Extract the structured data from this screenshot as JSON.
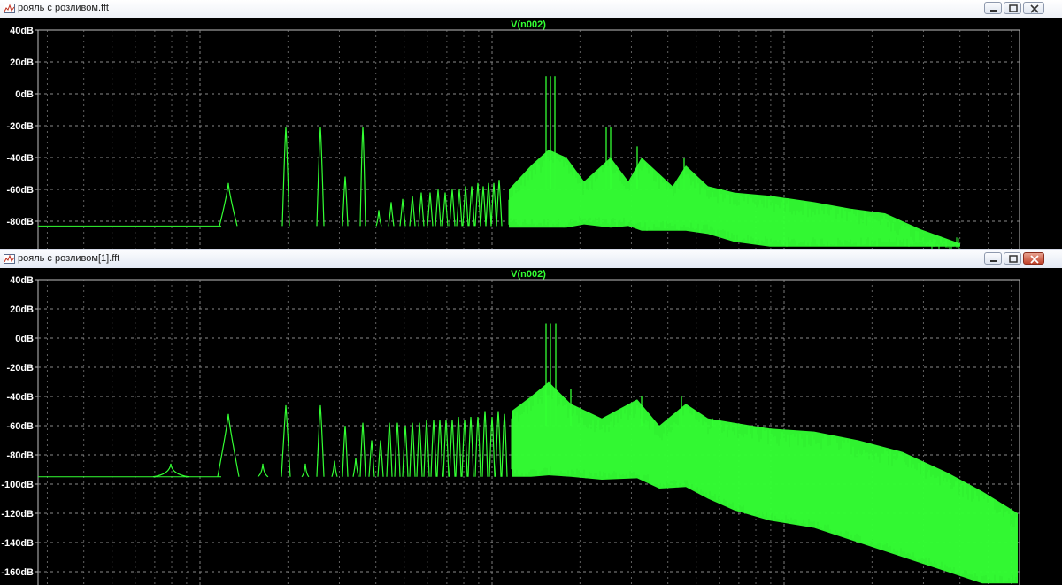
{
  "colors": {
    "trace": "#33ff33",
    "axis": "#bfbfbf",
    "grid": "#8a8a8a",
    "background": "#000000"
  },
  "windows": [
    {
      "title": "рояль с розливом.fft",
      "trace_label": "V(n002)",
      "y_ticks": [
        "40dB",
        "20dB",
        "0dB",
        "-20dB",
        "-40dB",
        "-60dB",
        "-80dB"
      ],
      "icons": [
        "app-icon",
        "minimize-icon",
        "maximize-icon",
        "close-icon"
      ]
    },
    {
      "title": "рояль с розливом[1].fft",
      "trace_label": "V(n002)",
      "y_ticks": [
        "40dB",
        "20dB",
        "0dB",
        "-20dB",
        "-40dB",
        "-60dB",
        "-80dB",
        "-100dB",
        "-120dB",
        "-140dB",
        "-160dB"
      ],
      "icons": [
        "app-icon",
        "minimize-icon",
        "maximize-icon",
        "close-icon"
      ]
    }
  ],
  "chart_data": [
    {
      "type": "line",
      "title": "V(n002)",
      "xlabel": "",
      "ylabel": "",
      "y_unit": "dB",
      "ylim_visible": [
        -96,
        40
      ],
      "x_scale": "log",
      "grid": true,
      "series": [
        {
          "name": "V(n002)",
          "peaks": [
            {
              "x_rel": 0.22,
              "db": -56
            },
            {
              "x_rel": 0.29,
              "db": -21
            },
            {
              "x_rel": 0.33,
              "db": -21
            },
            {
              "x_rel": 0.37,
              "db": -23
            },
            {
              "x_rel": 0.55,
              "db": 11
            },
            {
              "x_rel": 0.57,
              "db": 11
            },
            {
              "x_rel": 0.62,
              "db": -21
            },
            {
              "x_rel": 0.66,
              "db": -35
            },
            {
              "x_rel": 0.71,
              "db": -40
            }
          ],
          "noise_floor_db": -83
        }
      ]
    },
    {
      "type": "line",
      "title": "V(n002)",
      "xlabel": "",
      "ylabel": "",
      "y_unit": "dB",
      "ylim_visible": [
        -165,
        40
      ],
      "x_scale": "log",
      "grid": true,
      "series": [
        {
          "name": "V(n002)",
          "peaks": [
            {
              "x_rel": 0.16,
              "db": -86
            },
            {
              "x_rel": 0.22,
              "db": -52
            },
            {
              "x_rel": 0.26,
              "db": -86
            },
            {
              "x_rel": 0.29,
              "db": -46
            },
            {
              "x_rel": 0.33,
              "db": -46
            },
            {
              "x_rel": 0.55,
              "db": 10
            },
            {
              "x_rel": 0.57,
              "db": 10
            },
            {
              "x_rel": 0.64,
              "db": -32
            },
            {
              "x_rel": 0.69,
              "db": -40
            }
          ],
          "noise_floor_db": -95
        }
      ]
    }
  ]
}
